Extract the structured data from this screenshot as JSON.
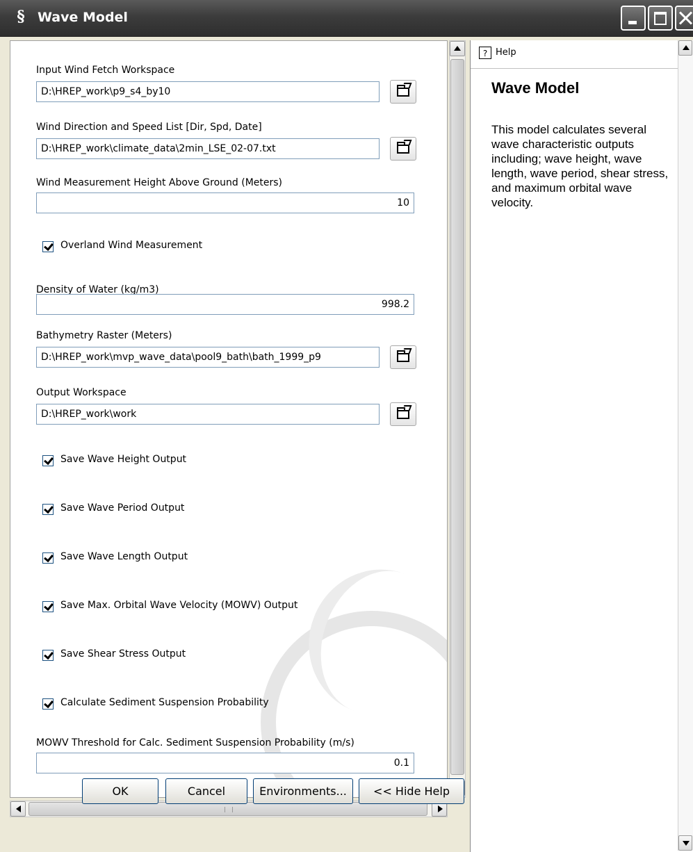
{
  "window": {
    "title": "Wave Model",
    "icon": "tool-s-icon"
  },
  "form": {
    "wind_fetch": {
      "label": "Input Wind Fetch Workspace",
      "value": "D:\\HREP_work\\p9_s4_by10"
    },
    "wind_list": {
      "label": "Wind Direction and Speed List [Dir, Spd, Date]",
      "value": "D:\\HREP_work\\climate_data\\2min_LSE_02-07.txt"
    },
    "wind_height": {
      "label": "Wind Measurement Height Above Ground (Meters)",
      "value": "10"
    },
    "overland": {
      "label": "Overland Wind Measurement",
      "checked": true
    },
    "density": {
      "label": "Density of Water (kg/m3)",
      "value": "998.2"
    },
    "bathymetry": {
      "label": "Bathymetry Raster (Meters)",
      "value": "D:\\HREP_work\\mvp_wave_data\\pool9_bath\\bath_1999_p9"
    },
    "output_ws": {
      "label": "Output Workspace",
      "value": "D:\\HREP_work\\work"
    },
    "checks": [
      {
        "label": "Save Wave Height Output",
        "checked": true
      },
      {
        "label": "Save Wave Period Output",
        "checked": true
      },
      {
        "label": "Save Wave Length Output",
        "checked": true
      },
      {
        "label": "Save Max. Orbital Wave Velocity (MOWV) Output",
        "checked": true
      },
      {
        "label": "Save Shear Stress Output",
        "checked": true
      },
      {
        "label": "Calculate Sediment Suspension Probability",
        "checked": true
      }
    ],
    "mowv_threshold": {
      "label": "MOWV Threshold for Calc. Sediment Suspension Probability (m/s)",
      "value": "0.1"
    }
  },
  "buttons": {
    "ok": "OK",
    "cancel": "Cancel",
    "environments": "Environments...",
    "hide_help": "<< Hide Help"
  },
  "help": {
    "tab": "Help",
    "title": "Wave Model",
    "body": "This model calculates several wave characteristic outputs including; wave height, wave length, wave period, shear stress, and maximum orbital wave velocity."
  }
}
